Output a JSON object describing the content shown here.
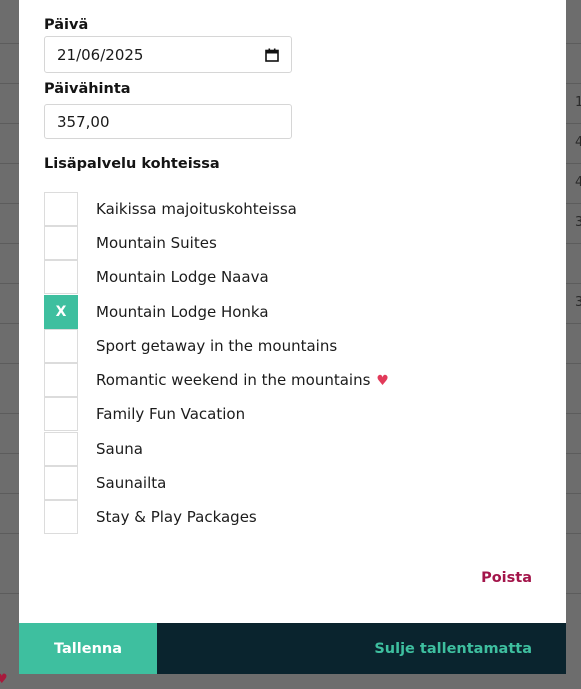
{
  "background": {
    "digits": [
      "1",
      "4",
      "4",
      "3",
      "3"
    ],
    "heart": "♥"
  },
  "form": {
    "date_label": "Päivä",
    "date_value": "21/06/2025",
    "price_label": "Päivähinta",
    "price_value": "357,00",
    "services_label": "Lisäpalvelu kohteissa",
    "services": [
      {
        "label": "Kaikissa majoituskohteissa",
        "checked": false,
        "mark": ""
      },
      {
        "label": "Mountain Suites",
        "checked": false,
        "mark": ""
      },
      {
        "label": "Mountain Lodge Naava",
        "checked": false,
        "mark": ""
      },
      {
        "label": "Mountain Lodge Honka",
        "checked": true,
        "mark": "X"
      },
      {
        "label": "Sport getaway in the mountains",
        "checked": false,
        "mark": ""
      },
      {
        "label": "Romantic weekend in the mountains",
        "checked": false,
        "mark": "",
        "emoji": "♥"
      },
      {
        "label": "Family Fun Vacation",
        "checked": false,
        "mark": ""
      },
      {
        "label": "Sauna",
        "checked": false,
        "mark": ""
      },
      {
        "label": "Saunailta",
        "checked": false,
        "mark": ""
      },
      {
        "label": "Stay & Play Packages",
        "checked": false,
        "mark": ""
      }
    ]
  },
  "actions": {
    "delete_label": "Poista",
    "save_label": "Tallenna",
    "close_label": "Sulje tallentamatta"
  },
  "colors": {
    "accent": "#3ebf9f",
    "dark": "#0a242e",
    "danger": "#a3154a"
  }
}
